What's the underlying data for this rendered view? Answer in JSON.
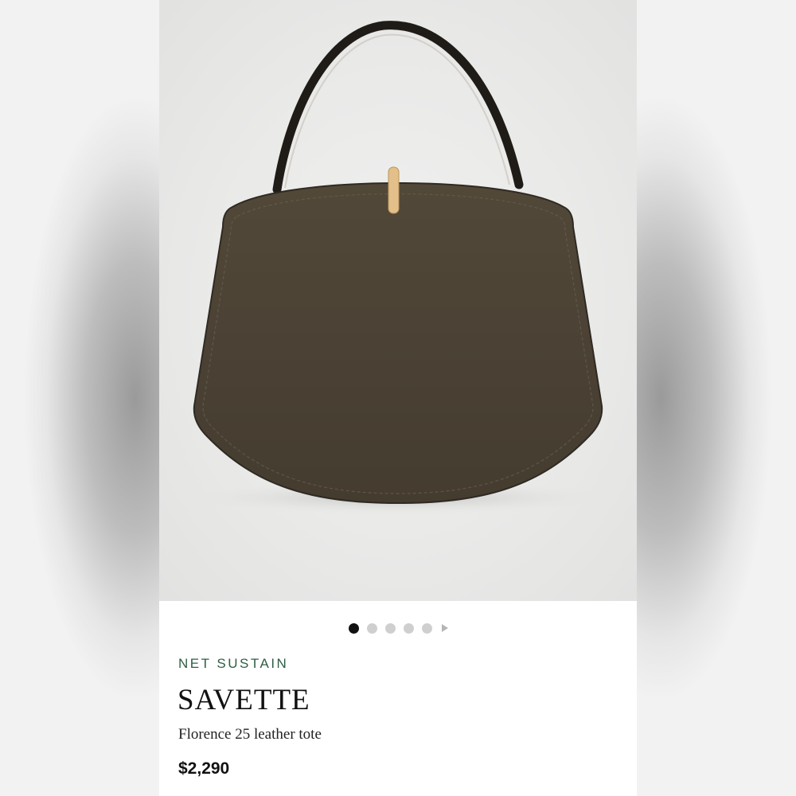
{
  "carousel": {
    "image_alt": "Florence 25 leather tote",
    "dots_count": 5,
    "active_index": 0
  },
  "product": {
    "tag": "NET SUSTAIN",
    "brand": "SAVETTE",
    "name": "Florence 25 leather tote",
    "price": "$2,290"
  },
  "colors": {
    "tag": "#2f5e45",
    "bag": "#4e4537",
    "clasp": "#e3c089"
  }
}
